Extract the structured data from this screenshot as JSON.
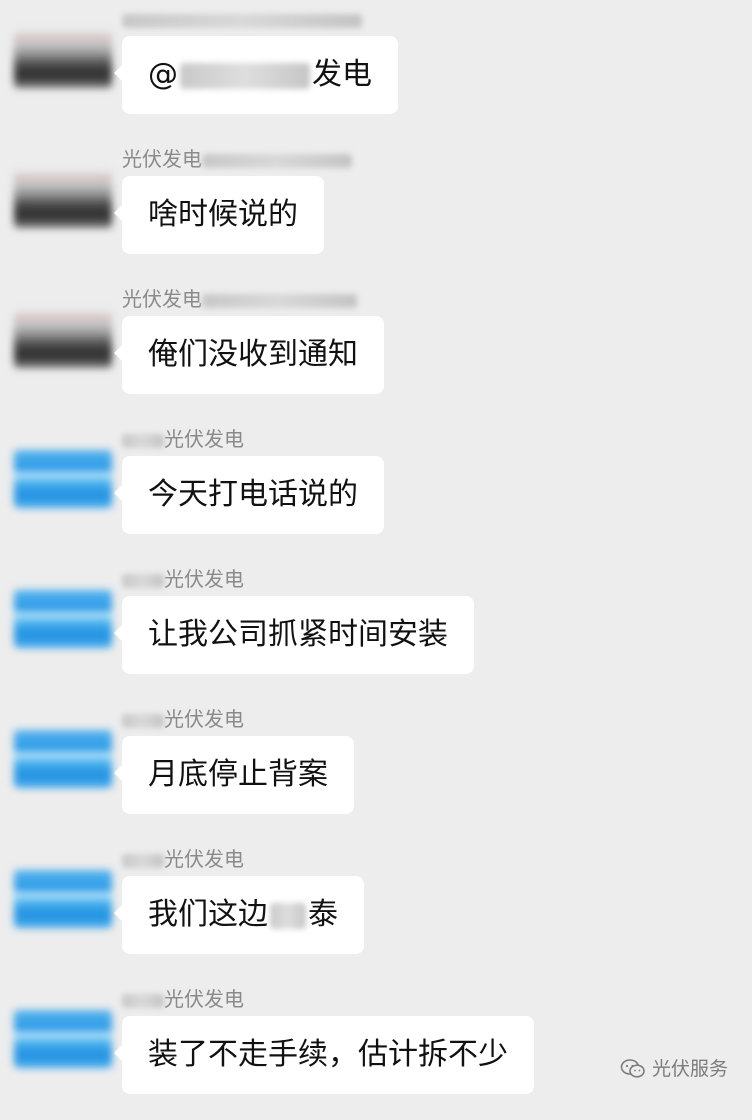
{
  "messages": [
    {
      "avatar": "dark",
      "sender": "",
      "text": "@",
      "text_after": "发电",
      "blur_inline": true,
      "blur_name": true
    },
    {
      "avatar": "dark",
      "sender": "光伏发电",
      "text": "啥时候说的",
      "sender_blur_after": true
    },
    {
      "avatar": "dark",
      "sender": "光伏发电",
      "text": "俺们没收到通知",
      "sender_blur_after": true
    },
    {
      "avatar": "blue",
      "sender": "光伏发电",
      "text": "今天打电话说的",
      "sender_blur_before": true
    },
    {
      "avatar": "blue",
      "sender": "光伏发电",
      "text": "让我公司抓紧时间安装",
      "sender_blur_before": true
    },
    {
      "avatar": "blue",
      "sender": "光伏发电",
      "text": "月底停止背案",
      "sender_blur_before": true
    },
    {
      "avatar": "blue",
      "sender": "光伏发电",
      "text": "我们这边",
      "text_after": "泰",
      "blur_inline_small": true,
      "sender_blur_before": true
    },
    {
      "avatar": "blue",
      "sender": "光伏发电",
      "text": "装了不走手续，估计拆不少",
      "sender_blur_before": true
    }
  ],
  "watermark": {
    "label": "光伏服务",
    "icon": "wechat-official-account-icon"
  }
}
